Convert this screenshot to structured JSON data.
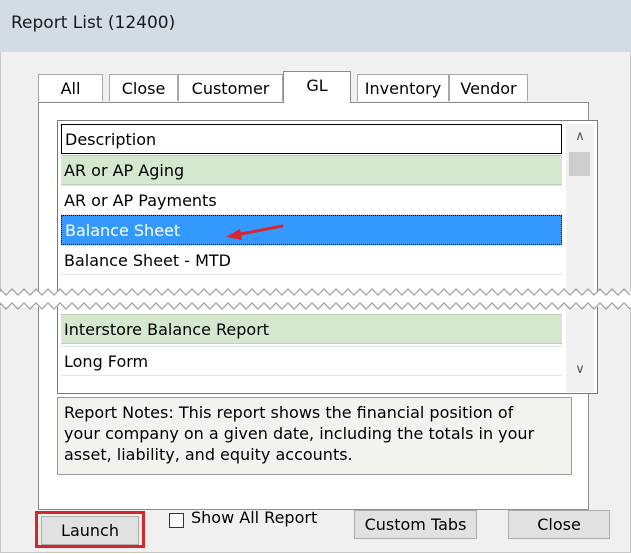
{
  "window": {
    "title": "Report List (12400)"
  },
  "tabs": [
    {
      "label": "All",
      "active": false
    },
    {
      "label": "Close",
      "active": false
    },
    {
      "label": "Customer",
      "active": false
    },
    {
      "label": "GL",
      "active": true
    },
    {
      "label": "Inventory",
      "active": false
    },
    {
      "label": "Vendor",
      "active": false
    }
  ],
  "list": {
    "header": "Description",
    "rows_top": [
      "AR or AP Aging",
      "AR or AP Payments",
      "Balance Sheet",
      "Balance Sheet - MTD"
    ],
    "rows_bottom": [
      "Interstore Balance Report",
      "Long Form"
    ],
    "selected": "Balance Sheet"
  },
  "notes": {
    "line1": "Report Notes:  This report shows the financial position of",
    "line2": "your company on a given date, including the totals in your",
    "line3": "asset, liability, and equity accounts."
  },
  "buttons": {
    "launch": "Launch",
    "show_all_report": "Show All Report",
    "custom_tabs": "Custom Tabs",
    "close": "Close"
  },
  "colors": {
    "highlight": "#d9262b",
    "selection": "#3399ff",
    "green_row": "#d3e8cf"
  }
}
